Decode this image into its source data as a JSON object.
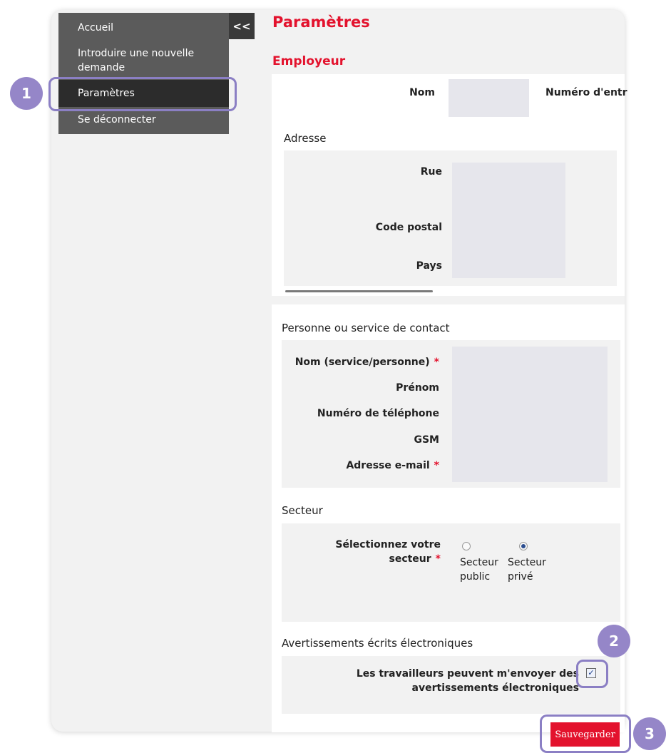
{
  "sidebar": {
    "items": [
      {
        "label": "Accueil"
      },
      {
        "label": "Introduire une nouvelle demande"
      },
      {
        "label": "Paramètres"
      },
      {
        "label": "Se déconnecter"
      }
    ],
    "collapse_label": "<<"
  },
  "page": {
    "title": "Paramètres"
  },
  "employeur": {
    "heading": "Employeur",
    "nom_label": "Nom",
    "numero_label": "Numéro d'entr",
    "adresse_heading": "Adresse",
    "rue_label": "Rue",
    "code_postal_label": "Code postal",
    "pays_label": "Pays"
  },
  "contact": {
    "heading": "Personne ou service de contact",
    "nom_label": "Nom (service/personne)",
    "prenom_label": "Prénom",
    "telephone_label": "Numéro de téléphone",
    "gsm_label": "GSM",
    "email_label": "Adresse e-mail",
    "required_mark": "*"
  },
  "secteur": {
    "heading": "Secteur",
    "select_label_line1": "Sélectionnez votre",
    "select_label_line2": "secteur",
    "options": [
      {
        "line1": "Secteur",
        "line2": "public",
        "selected": false
      },
      {
        "line1": "Secteur",
        "line2": "privé",
        "selected": true
      }
    ]
  },
  "avertissements": {
    "heading": "Avertissements écrits électroniques",
    "label_line1": "Les travailleurs peuvent m'envoyer des",
    "label_line2": "avertissements électroniques",
    "checked": true,
    "check_glyph": "✓"
  },
  "actions": {
    "save_label": "Sauvegarder"
  },
  "badges": [
    "1",
    "2",
    "3"
  ]
}
